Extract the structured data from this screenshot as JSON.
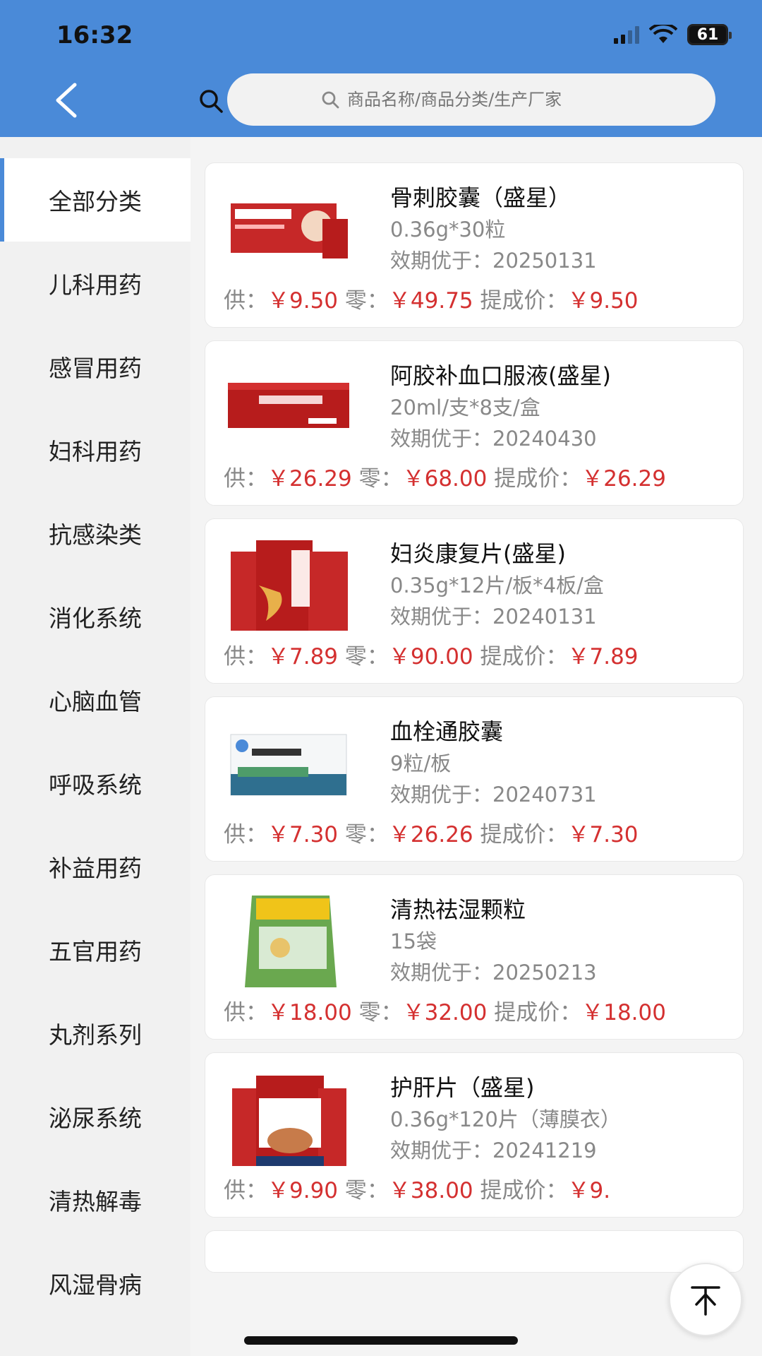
{
  "status": {
    "time": "16:32",
    "battery": "61"
  },
  "search": {
    "placeholder": "商品名称/商品分类/生产厂家"
  },
  "categories": [
    {
      "label": "全部分类",
      "active": true
    },
    {
      "label": "儿科用药"
    },
    {
      "label": "感冒用药"
    },
    {
      "label": "妇科用药"
    },
    {
      "label": "抗感染类"
    },
    {
      "label": "消化系统"
    },
    {
      "label": "心脑血管"
    },
    {
      "label": "呼吸系统"
    },
    {
      "label": "补益用药"
    },
    {
      "label": "五官用药"
    },
    {
      "label": "丸剂系列"
    },
    {
      "label": "泌尿系统"
    },
    {
      "label": "清热解毒"
    },
    {
      "label": "风湿骨病"
    }
  ],
  "price_labels": {
    "supply": "供：",
    "retail": "零：",
    "commission": "提成价："
  },
  "products": [
    {
      "name": "骨刺胶囊（盛星）",
      "spec": "0.36g*30粒",
      "expiry": "效期优于：20250131",
      "supply": "￥9.50",
      "retail": "￥49.75",
      "commission": "￥9.50",
      "image_icon": "red-medicine-box"
    },
    {
      "name": "阿胶补血口服液(盛星)",
      "spec": "20ml/支*8支/盒",
      "expiry": "效期优于：20240430",
      "supply": "￥26.29",
      "retail": "￥68.00",
      "commission": "￥26.29",
      "image_icon": "red-medicine-box"
    },
    {
      "name": "妇炎康复片(盛星)",
      "spec": "0.35g*12片/板*4板/盒",
      "expiry": "效期优于：20240131",
      "supply": "￥7.89",
      "retail": "￥90.00",
      "commission": "￥7.89",
      "image_icon": "red-medicine-box"
    },
    {
      "name": "血栓通胶囊",
      "spec": "9粒/板",
      "expiry": "效期优于：20240731",
      "supply": "￥7.30",
      "retail": "￥26.26",
      "commission": "￥7.30",
      "image_icon": "white-medicine-box"
    },
    {
      "name": "清热祛湿颗粒",
      "spec": "15袋",
      "expiry": "效期优于：20250213",
      "supply": "￥18.00",
      "retail": "￥32.00",
      "commission": "￥18.00",
      "image_icon": "green-medicine-bag"
    },
    {
      "name": "护肝片（盛星)",
      "spec": "0.36g*120片（薄膜衣）",
      "expiry": "效期优于：20241219",
      "supply": "￥9.90",
      "retail": "￥38.00",
      "commission": "￥9.",
      "image_icon": "red-medicine-box"
    }
  ],
  "colors": {
    "header": "#4a8ad8",
    "price": "#d43030",
    "accent": "#4a8ad8"
  },
  "icons": {
    "back": "chevron-left-icon",
    "scan": "search-icon",
    "top": "back-to-top-icon"
  }
}
